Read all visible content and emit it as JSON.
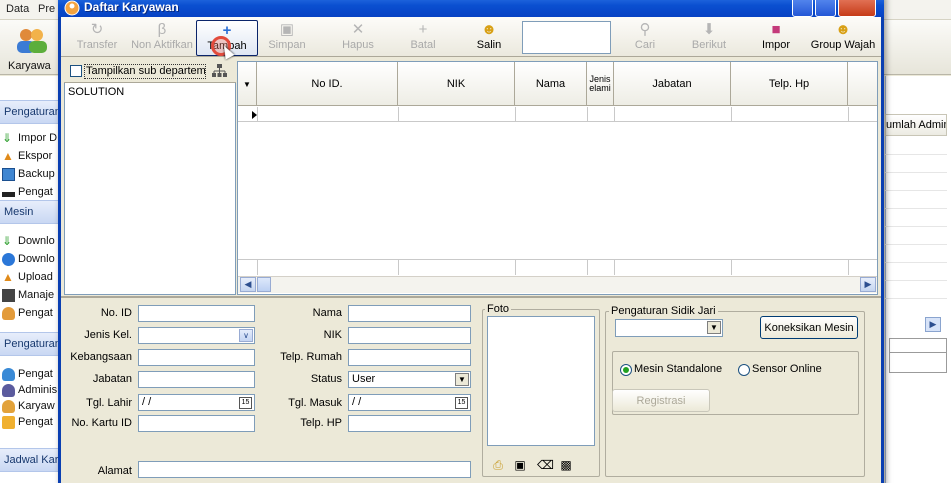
{
  "background_app": {
    "menu": [
      "Data",
      "Pre"
    ],
    "user_label": "Karyawa",
    "sections": [
      {
        "title": "Pengaturan",
        "items": [
          "Impor D",
          "Ekspor",
          "Backup",
          "Pengat"
        ]
      },
      {
        "title": "Mesin",
        "items": [
          "Downlo",
          "Downlo",
          "Upload",
          "Manaje",
          "Pengat"
        ]
      },
      {
        "title": "Pengaturan",
        "items": [
          "Pengat",
          "Adminis",
          "Karyaw",
          "Pengat"
        ]
      },
      {
        "title": "Jadwal Kar",
        "items": []
      }
    ],
    "right_header": "umlah Admin"
  },
  "window": {
    "title": "Daftar Karyawan"
  },
  "toolbar": {
    "buttons": [
      {
        "label": "Transfer",
        "icon": "transfer-icon",
        "enabled": false
      },
      {
        "label": "Non Aktifkan",
        "icon": "deactivate-icon",
        "enabled": false
      },
      {
        "label": "Tambah",
        "icon": "plus-icon",
        "enabled": true
      },
      {
        "label": "Simpan",
        "icon": "save-icon",
        "enabled": false
      },
      {
        "label": "Hapus",
        "icon": "delete-x-icon",
        "enabled": false
      },
      {
        "label": "Batal",
        "icon": "cancel-icon",
        "enabled": false
      },
      {
        "label": "Salin",
        "icon": "copy-people-icon",
        "enabled": true
      },
      {
        "label": "Cari",
        "icon": "search-pin-icon",
        "enabled": false
      },
      {
        "label": "Berikut",
        "icon": "next-arrow-icon",
        "enabled": false
      },
      {
        "label": "Impor",
        "icon": "import-person-icon",
        "enabled": true
      },
      {
        "label": "Group Wajah",
        "icon": "group-face-icon",
        "enabled": true
      }
    ],
    "search_value": ""
  },
  "departments": {
    "show_sub_label": "Tampilkan sub departemen",
    "show_sub_checked": false,
    "items": [
      "SOLUTION"
    ]
  },
  "grid": {
    "columns": [
      "No ID.",
      "NIK",
      "Nama",
      "Jenis Kelamin",
      "Jabatan",
      "Telp. Hp"
    ],
    "jenis_line1": "Jenis",
    "jenis_line2": "elami"
  },
  "form": {
    "no_id": {
      "label": "No. ID",
      "value": ""
    },
    "jenis_kel": {
      "label": "Jenis Kel.",
      "value": ""
    },
    "kebangsaan": {
      "label": "Kebangsaan",
      "value": ""
    },
    "jabatan": {
      "label": "Jabatan",
      "value": ""
    },
    "tgl_lahir": {
      "label": "Tgl. Lahir",
      "value": " /  /"
    },
    "no_kartu": {
      "label": "No. Kartu ID",
      "value": ""
    },
    "alamat": {
      "label": "Alamat",
      "value": ""
    },
    "nama": {
      "label": "Nama",
      "value": ""
    },
    "nik": {
      "label": "NIK",
      "value": ""
    },
    "telp_rumah": {
      "label": "Telp. Rumah",
      "value": ""
    },
    "status": {
      "label": "Status",
      "value": "User"
    },
    "tgl_masuk": {
      "label": "Tgl. Masuk",
      "value": " /  /"
    },
    "telp_hp": {
      "label": "Telp. HP",
      "value": ""
    }
  },
  "foto": {
    "label": "Foto"
  },
  "fingerprint": {
    "title": "Pengaturan Sidik Jari",
    "device_value": "",
    "connect_button": "Koneksikan Mesin",
    "radio_standalone": "Mesin Standalone",
    "radio_sensor": "Sensor Online",
    "selected": "standalone",
    "register_button": "Registrasi"
  }
}
